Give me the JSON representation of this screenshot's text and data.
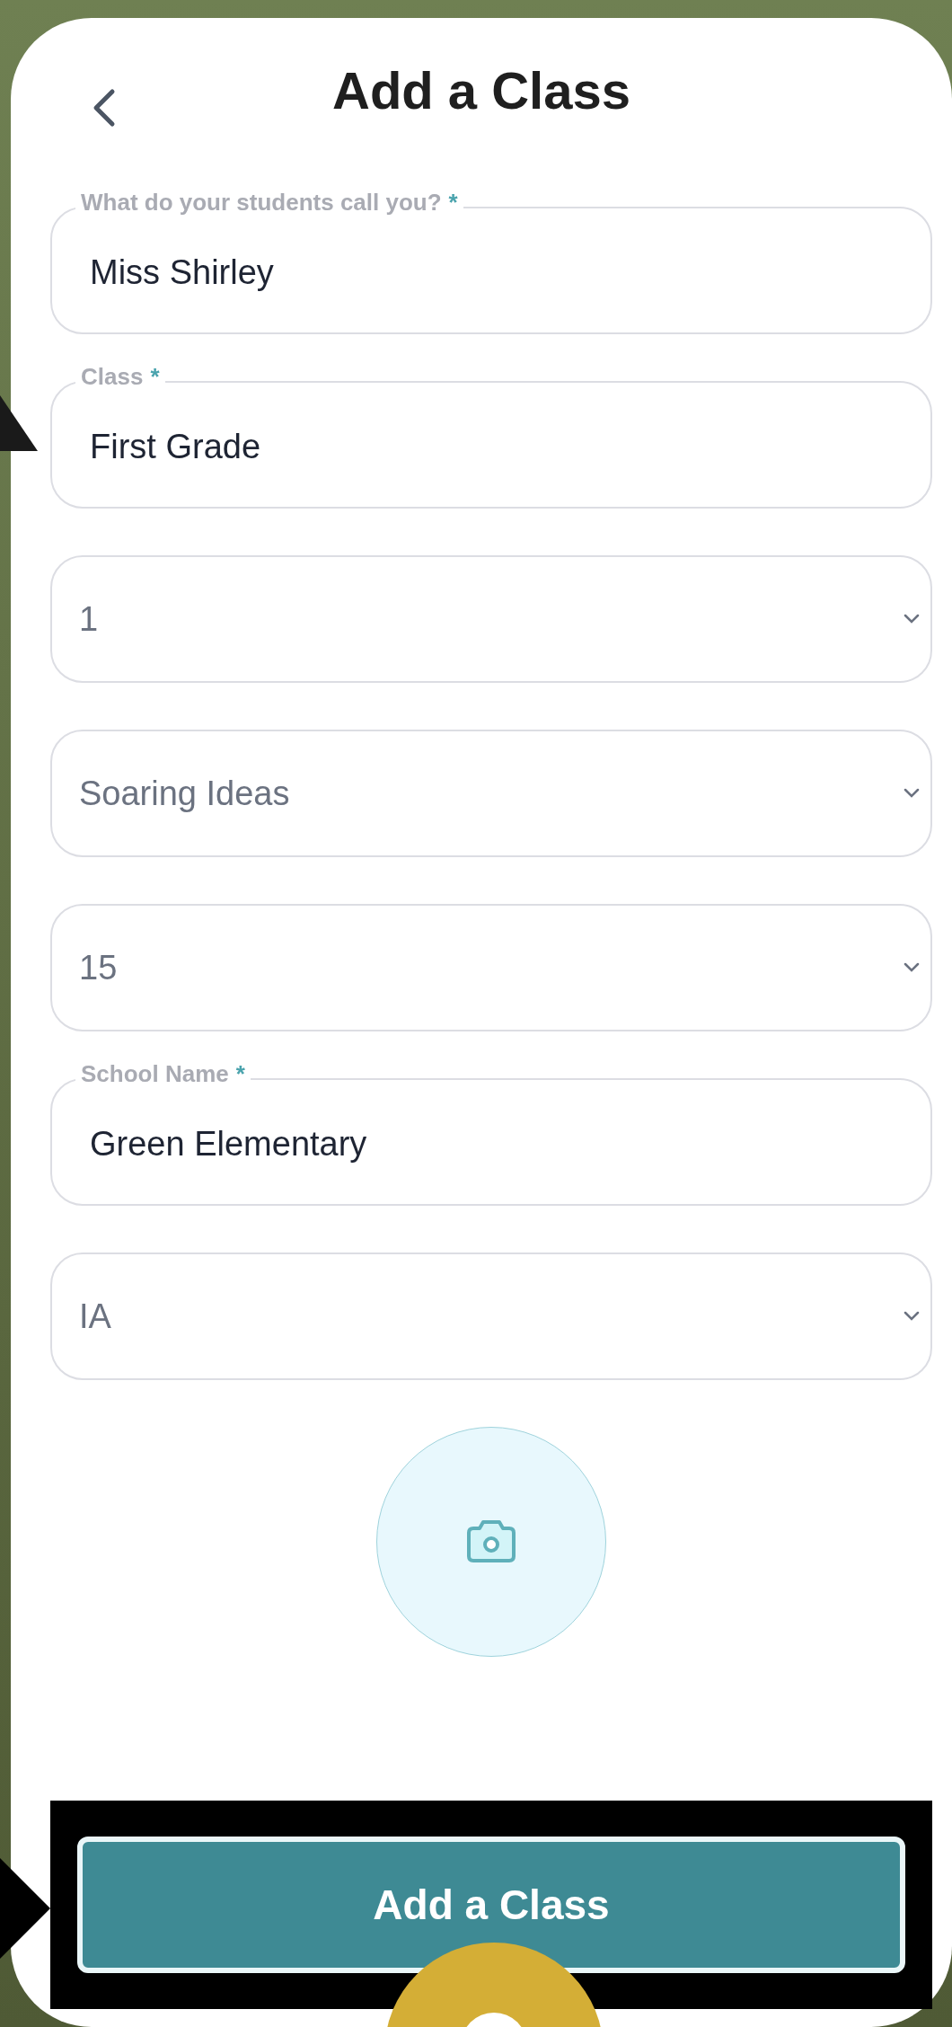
{
  "header": {
    "title": "Add a Class"
  },
  "fields": [
    {
      "kind": "text",
      "label": "What do your students call you?",
      "mark": "*",
      "value": "Miss Shirley"
    },
    {
      "kind": "text",
      "label": "Class",
      "mark": "*",
      "value": "First Grade"
    },
    {
      "kind": "select",
      "value": "1"
    },
    {
      "kind": "select",
      "value": "Soaring Ideas"
    },
    {
      "kind": "select",
      "value": "15"
    },
    {
      "kind": "text",
      "label": "School Name",
      "mark": "*",
      "value": "Green Elementary"
    },
    {
      "kind": "select",
      "value": "IA"
    }
  ],
  "submit": {
    "label": "Add a Class"
  }
}
